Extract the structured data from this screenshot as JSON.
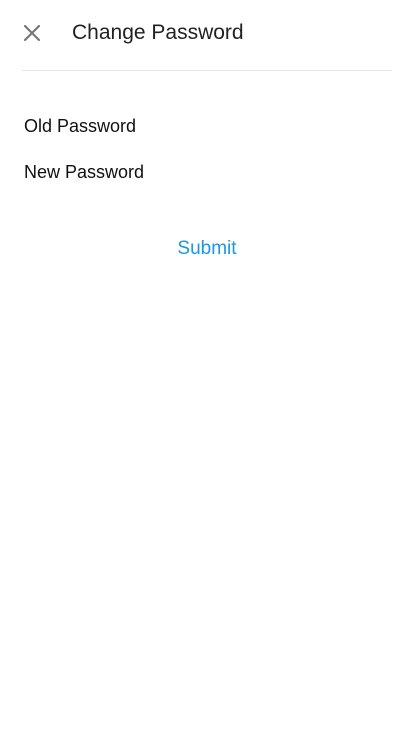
{
  "header": {
    "title": "Change Password",
    "close_icon": "close-icon"
  },
  "form": {
    "old_password": {
      "placeholder": "Old Password",
      "value": ""
    },
    "new_password": {
      "placeholder": "New Password",
      "value": ""
    },
    "submit_label": "Submit"
  },
  "colors": {
    "accent": "#1a98e3",
    "text": "#222222",
    "divider": "#e6e6e6",
    "icon": "#777777"
  }
}
